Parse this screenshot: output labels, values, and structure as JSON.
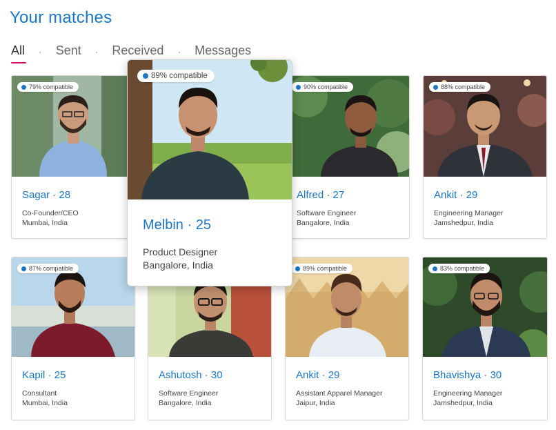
{
  "header": {
    "title": "Your matches"
  },
  "tabs": [
    {
      "label": "All",
      "active": true
    },
    {
      "label": "Sent",
      "active": false
    },
    {
      "label": "Received",
      "active": false
    },
    {
      "label": "Messages",
      "active": false
    }
  ],
  "tab_separator": "·",
  "colors": {
    "accent": "#1a76c4",
    "tab_underline": "#d8106e"
  },
  "cards": [
    {
      "name": "Sagar",
      "age": "28",
      "compat": "79% compatible",
      "role": "Co-Founder/CEO",
      "location": "Mumbai, India"
    },
    {
      "name": "Melbin",
      "age": "25",
      "compat": "89% compatible",
      "role": "Product Designer",
      "location": "Bangalore, India"
    },
    {
      "name": "Alfred",
      "age": "27",
      "compat": "90% compatible",
      "role": "Software Engineer",
      "location": "Bangalore, India"
    },
    {
      "name": "Ankit",
      "age": "29",
      "compat": "88% compatible",
      "role": "Engineering Manager",
      "location": "Jamshedpur, India"
    },
    {
      "name": "Kapil",
      "age": "25",
      "compat": "87% compatible",
      "role": "Consultant",
      "location": "Mumbai, India"
    },
    {
      "name": "Ashutosh",
      "age": "30",
      "compat": "",
      "role": "Software Engineer",
      "location": "Bangalore, India"
    },
    {
      "name": "Ankit",
      "age": "29",
      "compat": "89% compatible",
      "role": "Assistant Apparel Manager",
      "location": "Jaipur, India"
    },
    {
      "name": "Bhavishya",
      "age": "30",
      "compat": "83% compatible",
      "role": "Engineering Manager",
      "location": "Jamshedpur, India"
    }
  ]
}
